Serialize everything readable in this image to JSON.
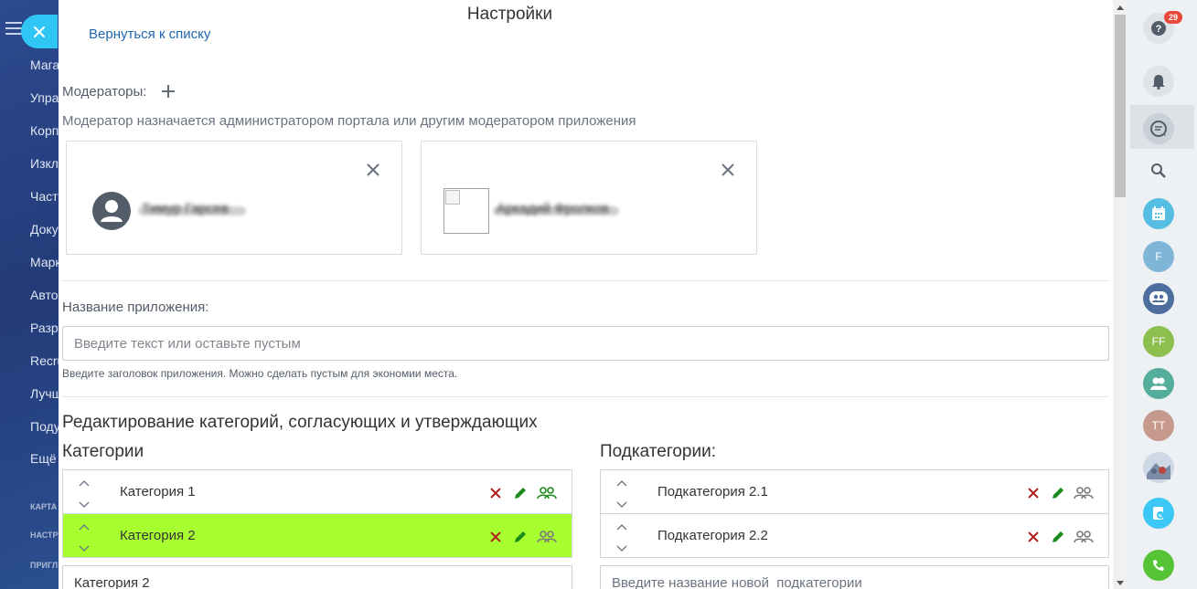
{
  "sidebar": {
    "items": [
      "Мага",
      "Упра",
      "Корп",
      "Изкл",
      "Част",
      "Доку",
      "Марк",
      "Авто",
      "Разр",
      "Recru",
      "Лучш",
      "Поду",
      "Ещё"
    ],
    "sections": [
      "КАРТА",
      "НАСТР",
      "ПРИГЛ"
    ]
  },
  "header": {
    "title": "Настройки",
    "back_link": "Вернуться к списку"
  },
  "moderators": {
    "label": "Модераторы:",
    "hint": "Модератор назначается администратором портала или другим модератором приложения",
    "cards": [
      {
        "name": "Тимур Гарсев"
      },
      {
        "name": "Аркадий Фролков"
      }
    ]
  },
  "app_name": {
    "label": "Название приложения:",
    "placeholder": "Введите текст или оставьте пустым",
    "value": "",
    "hint": "Введите заголовок приложения. Можно сделать пустым для экономии места."
  },
  "editing": {
    "section_title": "Редактирование категорий, согласующих и утверждающих",
    "categories_title": "Категории",
    "subcategories_title": "Подкатегории:",
    "categories": [
      {
        "label": "Категория 1",
        "active": false
      },
      {
        "label": "Категория 2",
        "active": true
      }
    ],
    "subcategories": [
      {
        "label": "Подкатегория 2.1"
      },
      {
        "label": "Подкатегория 2.2"
      }
    ],
    "category_input_value": "Категория 2",
    "subcategory_input_placeholder": "Введите название новой  подкатегории"
  },
  "right_bar": {
    "help_badge": "29",
    "avatars": [
      "F",
      "FF",
      "TT"
    ]
  },
  "colors": {
    "accent_blue": "#2fc6f6",
    "link": "#2067b0",
    "active_row": "#a8ff2f",
    "delete": "#c0392b",
    "edit": "#1a8a1a",
    "group_active": "#1a8a1a",
    "group_inactive": "#7a7a7a"
  }
}
